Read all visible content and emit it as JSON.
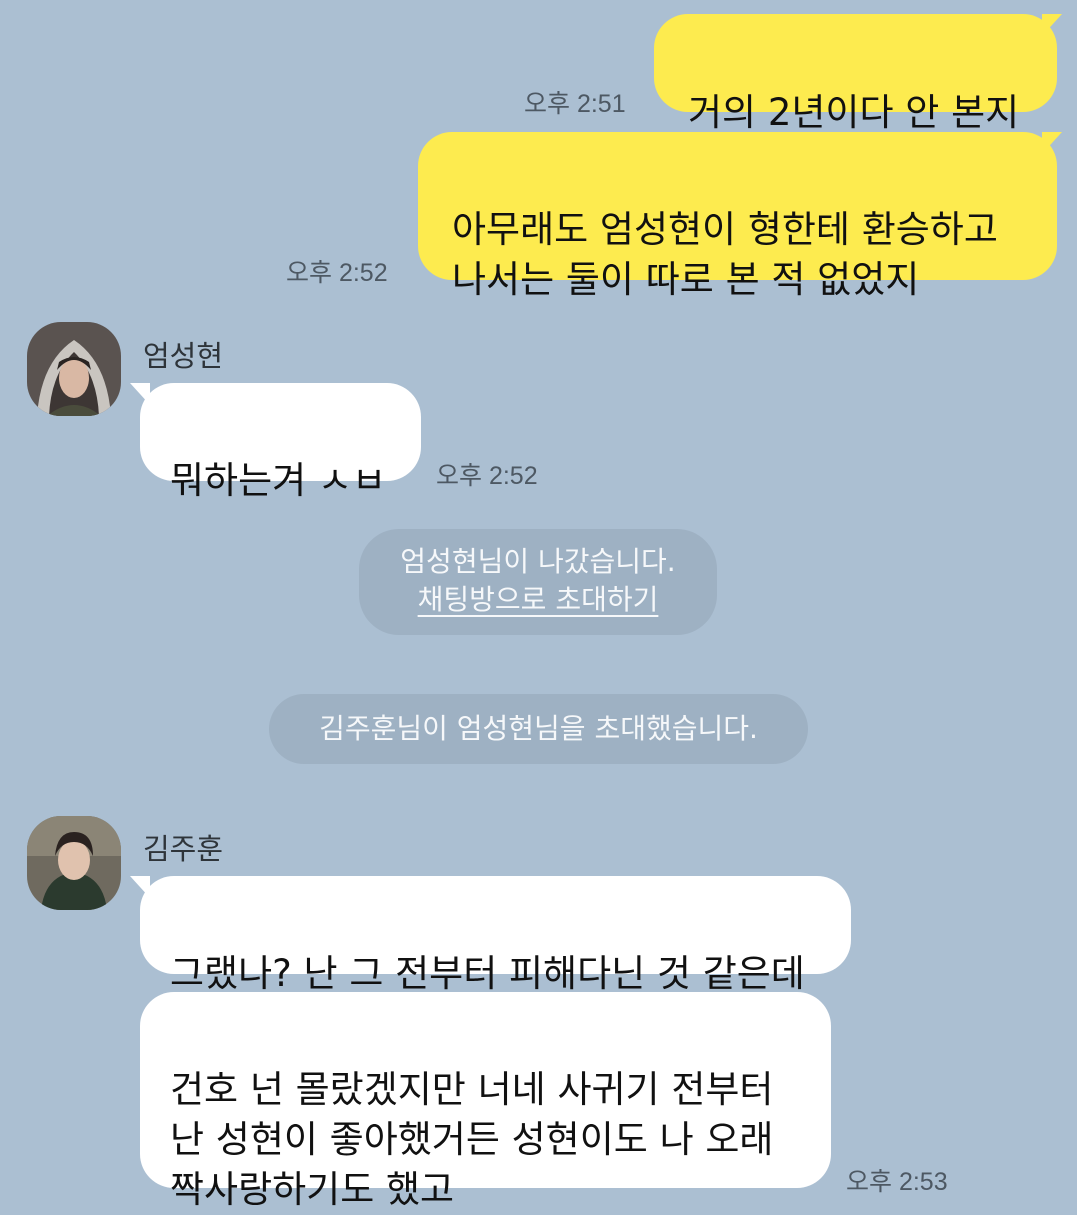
{
  "colors": {
    "background": "#abbfd2",
    "my_bubble": "#fdeb4f",
    "their_bubble": "#ffffff",
    "system_notice_bg": "#9eb1c3"
  },
  "messages": [
    {
      "sender": "me",
      "text": "거의 2년이다 안 본지",
      "time": "오후 2:51"
    },
    {
      "sender": "me",
      "text": "아무래도 엄성현이 형한테 환승하고\n나서는 둘이 따로 본 적 없었지",
      "time": "오후 2:52"
    },
    {
      "sender": "엄성현",
      "text": "뭐하는겨 ㅅㅂ",
      "time": "오후 2:52"
    },
    {
      "sender": "김주훈",
      "text": "그랬나? 난 그 전부터 피해다닌 것 같은데"
    },
    {
      "sender": "김주훈",
      "text": "건호 넌 몰랐겠지만 너네 사귀기 전부터\n난 성현이 좋아했거든 성현이도 나 오래\n짝사랑하기도 했고",
      "time": "오후 2:53"
    }
  ],
  "system": {
    "left_text": "엄성현님이 나갔습니다.",
    "invite_link": "채팅방으로 초대하기",
    "invited_text": "김주훈님이 엄성현님을 초대했습니다."
  },
  "people": {
    "user1_name": "엄성현",
    "user2_name": "김주훈"
  }
}
